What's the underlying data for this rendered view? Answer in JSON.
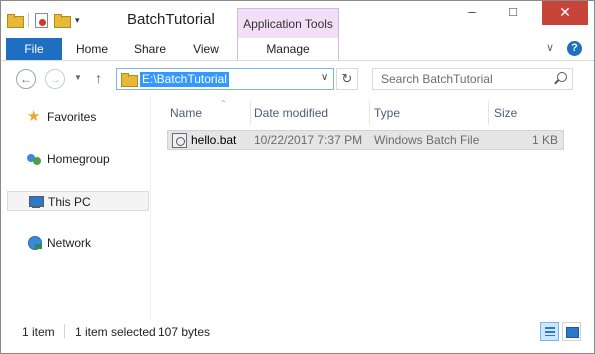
{
  "window": {
    "title": "BatchTutorial",
    "context_tab_header": "Application Tools"
  },
  "ribbon": {
    "tabs": [
      {
        "label": "File"
      },
      {
        "label": "Home"
      },
      {
        "label": "Share"
      },
      {
        "label": "View"
      },
      {
        "label": "Manage"
      }
    ],
    "help_label": "?"
  },
  "navigation": {
    "address": "E:\\BatchTutorial",
    "search_placeholder": "Search BatchTutorial"
  },
  "navpane": {
    "items": [
      {
        "label": "Favorites",
        "icon": "star-icon"
      },
      {
        "label": "Homegroup",
        "icon": "homegroup-icon"
      },
      {
        "label": "This PC",
        "icon": "computer-icon"
      },
      {
        "label": "Network",
        "icon": "network-icon"
      }
    ]
  },
  "filelist": {
    "columns": [
      {
        "label": "Name"
      },
      {
        "label": "Date modified"
      },
      {
        "label": "Type"
      },
      {
        "label": "Size"
      }
    ],
    "files": [
      {
        "name": "hello.bat",
        "date": "10/22/2017 7:37 PM",
        "type": "Windows Batch File",
        "size": "1 KB",
        "icon": "batch-file-icon"
      }
    ]
  },
  "status": {
    "item_count": "1 item",
    "selected": "1 item selected",
    "selected_size": "107 bytes"
  },
  "colors": {
    "file_tab": "#1e6fc2",
    "context_tab": "#f2dff7",
    "close_button": "#c7443a",
    "address_highlight": "#3399ff"
  }
}
